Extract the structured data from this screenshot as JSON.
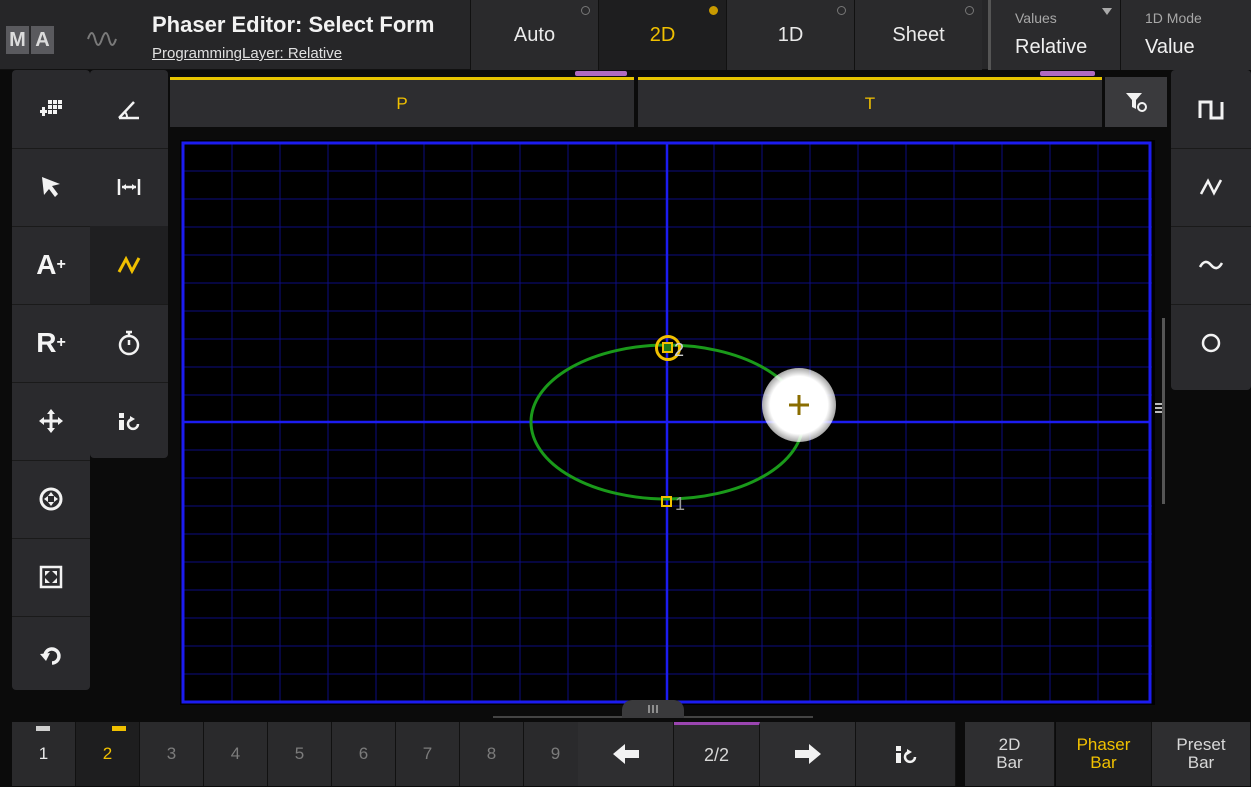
{
  "header": {
    "logo": [
      "M",
      "A"
    ],
    "title": "Phaser Editor: Select Form",
    "subtitle": "ProgrammingLayer: Relative"
  },
  "modes": [
    {
      "label": "Auto",
      "active": false
    },
    {
      "label": "2D",
      "active": true
    },
    {
      "label": "1D",
      "active": false
    },
    {
      "label": "Sheet",
      "active": false
    }
  ],
  "values_box": {
    "label": "Values",
    "value": "Relative"
  },
  "mode1d_box": {
    "label": "1D Mode",
    "value": "Value"
  },
  "attributes": [
    "P",
    "T"
  ],
  "left_tools_a": [
    {
      "icon": "grid-add-icon",
      "glyph": ""
    },
    {
      "icon": "cursor-icon",
      "glyph": ""
    },
    {
      "icon": "absolute-plus-icon",
      "glyph": "A"
    },
    {
      "icon": "relative-plus-icon",
      "glyph": "R"
    },
    {
      "icon": "move-icon",
      "glyph": ""
    },
    {
      "icon": "center-icon",
      "glyph": ""
    },
    {
      "icon": "fit-icon",
      "glyph": ""
    },
    {
      "icon": "undo-icon",
      "glyph": ""
    }
  ],
  "left_tools_b": [
    {
      "icon": "angle-icon"
    },
    {
      "icon": "width-icon"
    },
    {
      "icon": "zigzag-icon"
    },
    {
      "icon": "stopwatch-icon"
    },
    {
      "icon": "phaser-swap-icon"
    }
  ],
  "right_tools": [
    {
      "icon": "square-wave-icon"
    },
    {
      "icon": "zigzag-wave-icon"
    },
    {
      "icon": "sine-wave-icon"
    },
    {
      "icon": "circle-form-icon"
    }
  ],
  "plot": {
    "step1_label": "1",
    "step2_label": "2"
  },
  "bottom": {
    "steps": [
      "1",
      "2",
      "3",
      "4",
      "5",
      "6",
      "7",
      "8",
      "9"
    ],
    "selected_step": "2",
    "page": "2/2",
    "bar_2d": [
      "2D",
      "Bar"
    ],
    "phaser_bar": [
      "Phaser",
      "Bar"
    ],
    "preset_bar": [
      "Preset",
      "Bar"
    ]
  },
  "colors": {
    "accent": "#f0c000",
    "grid_axes": "#1c1cf0",
    "ellipse": "#1a9a1a"
  }
}
